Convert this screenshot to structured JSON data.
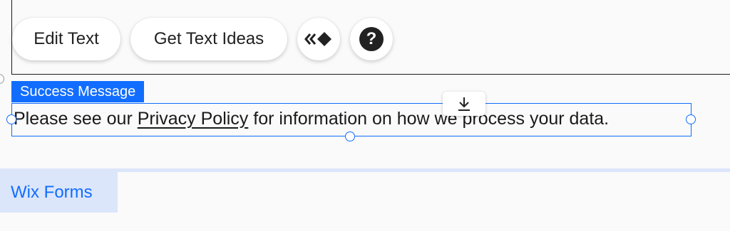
{
  "toolbar": {
    "edit_text_label": "Edit Text",
    "get_ideas_label": "Get Text Ideas",
    "animation_icon": "chevron-diamond-icon",
    "help_icon": "question-mark-icon",
    "help_glyph": "?"
  },
  "element": {
    "tag_label": "Success Message",
    "text_before": "Please see our ",
    "link_text": "Privacy Policy",
    "text_after": " for information on how we process your data.",
    "download_icon": "download-icon"
  },
  "footer_tab": {
    "label": "Wix Forms"
  },
  "colors": {
    "accent": "#116dff",
    "tab_background": "#dce6fb",
    "text": "#1a1a1a"
  }
}
